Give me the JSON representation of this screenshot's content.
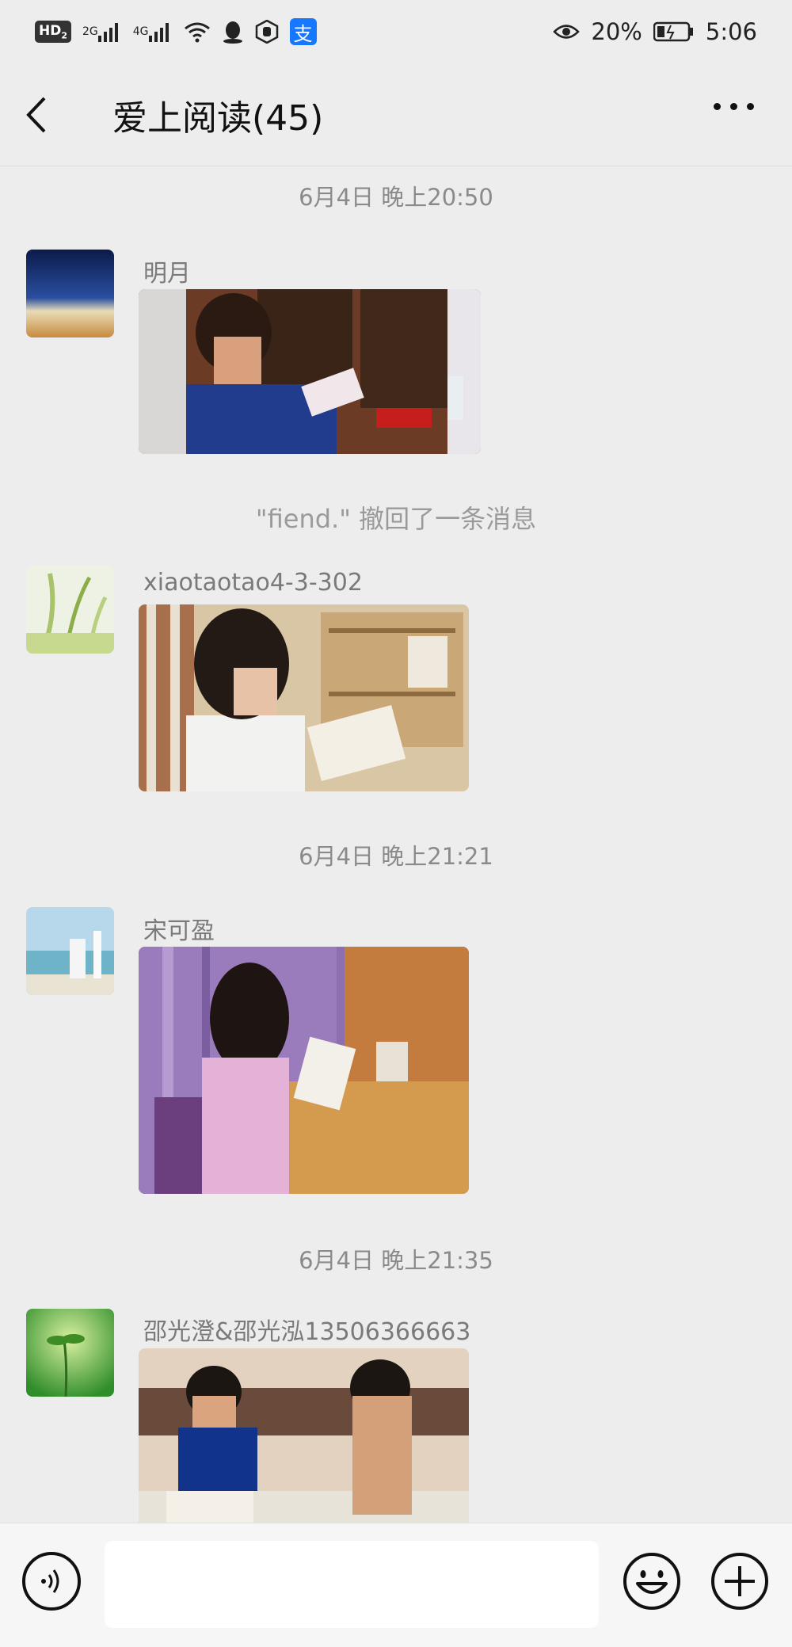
{
  "status_bar": {
    "hd_label": "HD",
    "hd_sub": "2",
    "net1": "2G",
    "net2": "4G",
    "battery_text": "20%",
    "time": "5:06"
  },
  "header": {
    "title": "爱上阅读(45)"
  },
  "messages": [
    {
      "timestamp": "6月4日 晚上20:50"
    },
    {
      "sender": "明月"
    },
    {
      "system": "\"fiend.\" 撤回了一条消息"
    },
    {
      "sender": "xiaotaotao4-3-302"
    },
    {
      "timestamp": "6月4日 晚上21:21"
    },
    {
      "sender": "宋可盈"
    },
    {
      "timestamp": "6月4日 晚上21:35"
    },
    {
      "sender": "邵光澄&邵光泓13506366663"
    }
  ],
  "icons": {
    "back": "chevron-left-icon",
    "more": "more-dots-icon",
    "voice": "voice-icon",
    "emoji": "emoji-icon",
    "plus": "plus-icon"
  },
  "colors": {
    "background": "#ededed",
    "timestamp_text": "#8a8a8a",
    "sender_text": "#7a7a7a"
  }
}
